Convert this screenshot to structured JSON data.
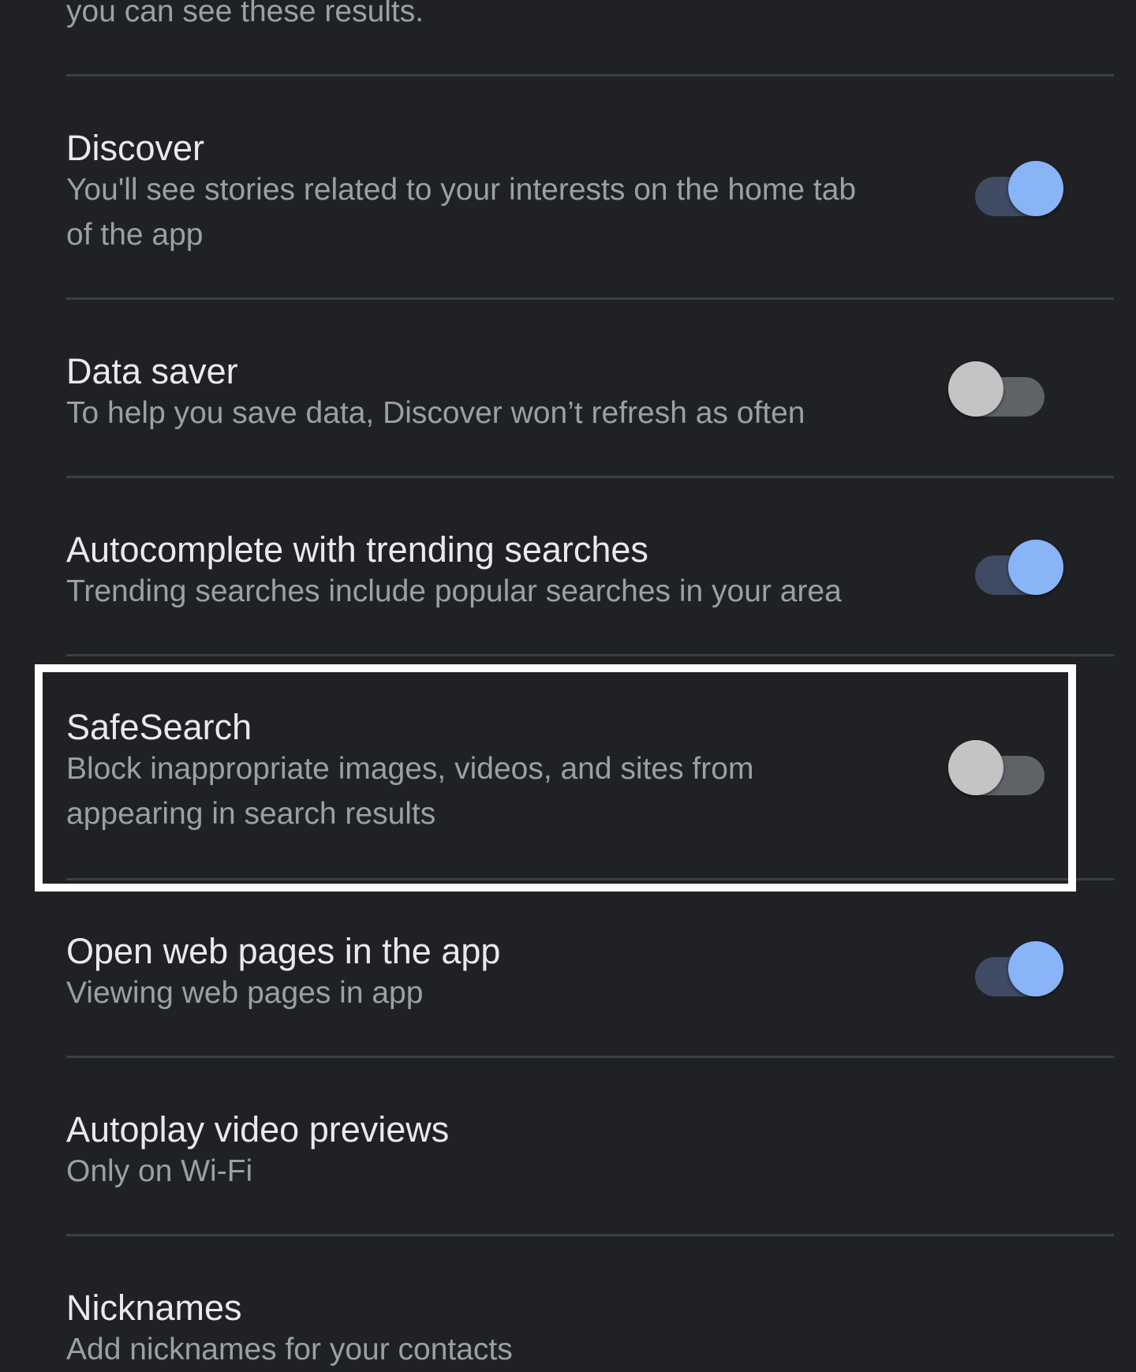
{
  "top_partial_text": "you can see these results.",
  "settings": [
    {
      "title": "Discover",
      "description": "You'll see stories related to your interests on the home tab of the app",
      "toggle": "on"
    },
    {
      "title": "Data saver",
      "description": "To help you save data, Discover won’t refresh as often",
      "toggle": "off"
    },
    {
      "title": "Autocomplete with trending searches",
      "description": "Trending searches include popular searches in your area",
      "toggle": "on"
    },
    {
      "title": "SafeSearch",
      "description": "Block inappropriate images, videos, and sites from appearing in search results",
      "toggle": "off",
      "highlighted": true
    },
    {
      "title": "Open web pages in the app",
      "description": "Viewing web pages in app",
      "toggle": "on"
    },
    {
      "title": "Autoplay video previews",
      "description": "Only on Wi-Fi"
    },
    {
      "title": "Nicknames",
      "description": "Add nicknames for your contacts"
    }
  ],
  "colors": {
    "background": "#202124",
    "title_text": "#e8eaed",
    "description_text": "#9aa0a6",
    "divider": "#3c4043",
    "toggle_on_thumb": "#8ab4f8",
    "toggle_on_track": "#3f4a63",
    "toggle_off_thumb": "#c4c4c4",
    "toggle_off_track": "#5f6368",
    "highlight_border": "#ffffff"
  }
}
